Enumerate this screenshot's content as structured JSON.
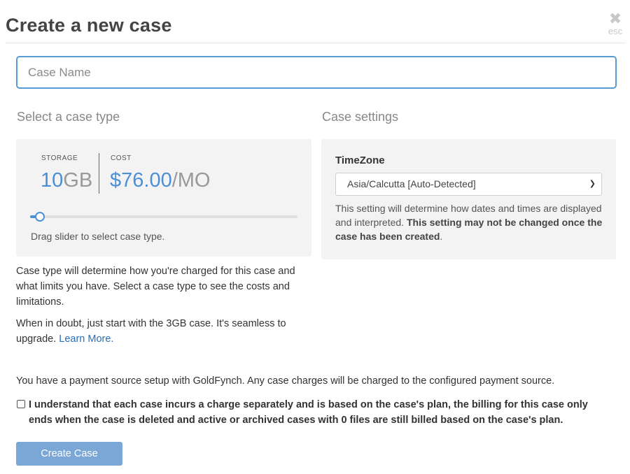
{
  "modal": {
    "title": "Create a new case",
    "close_label": "esc"
  },
  "case_name": {
    "placeholder": "Case Name",
    "value": ""
  },
  "case_type": {
    "section_title": "Select a case type",
    "storage_label": "STORAGE",
    "storage_number": "10",
    "storage_unit": "GB",
    "cost_label": "COST",
    "cost_amount": "$76.00",
    "cost_period": "/MO",
    "slider_level": 0.02,
    "slider_hint": "Drag slider to select case type.",
    "description_1": "Case type will determine how you're charged for this case and what limits you have. Select a case type to see the costs and limitations.",
    "description_2_prefix": "When in doubt, just start with the 3GB case. It's seamless to upgrade. ",
    "learn_more": "Learn More."
  },
  "case_settings": {
    "section_title": "Case settings",
    "timezone_label": "TimeZone",
    "timezone_selected": "Asia/Calcutta [Auto-Detected]",
    "help_normal": "This setting will determine how dates and times are displayed and interpreted. ",
    "help_bold": "This setting may not be changed once the case has been created",
    "help_end": "."
  },
  "payment_note": "You have a payment source setup with GoldFynch. Any case charges will be charged to the configured payment source.",
  "agreement": {
    "checked": false,
    "text": "I understand that each case incurs a charge separately and is based on the case's plan, the billing for this case only ends when the case is deleted and active or archived cases with 0 files are still billed based on the case's plan."
  },
  "create_button": "Create Case",
  "colors": {
    "accent": "#4a8fd8",
    "button": "#7aa7d6",
    "panel": "#f3f3f3",
    "link": "#2a6eb8"
  }
}
